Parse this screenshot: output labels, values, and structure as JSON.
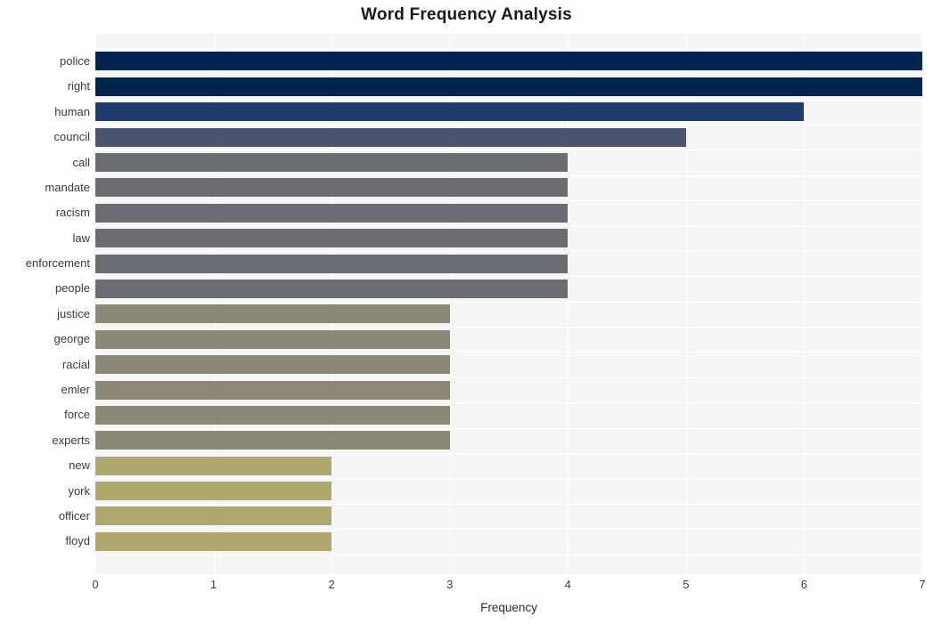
{
  "chart_data": {
    "type": "bar",
    "orientation": "horizontal",
    "title": "Word Frequency Analysis",
    "xlabel": "Frequency",
    "ylabel": "",
    "xlim": [
      0,
      7
    ],
    "xticks": [
      0,
      1,
      2,
      3,
      4,
      5,
      6,
      7
    ],
    "xtick_labels": [
      "0",
      "1",
      "2",
      "3",
      "4",
      "5",
      "6",
      "7"
    ],
    "grid": true,
    "legend": false,
    "categories": [
      "police",
      "right",
      "human",
      "council",
      "call",
      "mandate",
      "racism",
      "law",
      "enforcement",
      "people",
      "justice",
      "george",
      "racial",
      "emler",
      "force",
      "experts",
      "new",
      "york",
      "officer",
      "floyd"
    ],
    "values": [
      7,
      7,
      6,
      5,
      4,
      4,
      4,
      4,
      4,
      4,
      3,
      3,
      3,
      3,
      3,
      3,
      2,
      2,
      2,
      2
    ],
    "bar_colors": [
      "#022450",
      "#022450",
      "#1f3c6d",
      "#4b5570",
      "#6c6d72",
      "#6c6d72",
      "#6c6d72",
      "#6c6d72",
      "#6c6d72",
      "#6c6d72",
      "#8b8878",
      "#8b8878",
      "#8b8878",
      "#8b8878",
      "#8b8878",
      "#8b8878",
      "#b0a76d",
      "#b0a76d",
      "#b0a76d",
      "#b0a76d"
    ],
    "plot_background": "#f5f5f6",
    "grid_color": "#ffffff"
  }
}
